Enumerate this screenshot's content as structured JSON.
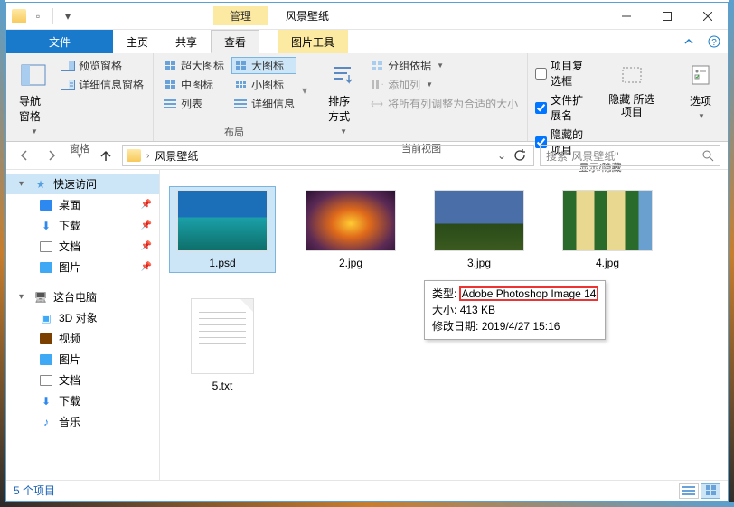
{
  "titlebar": {
    "context_tab": "管理",
    "title": "风景壁纸"
  },
  "menutabs": {
    "file": "文件",
    "home": "主页",
    "share": "共享",
    "view": "查看",
    "picture_tools": "图片工具"
  },
  "ribbon": {
    "panes": {
      "nav_pane": "导航窗格",
      "preview_pane": "预览窗格",
      "details_pane": "详细信息窗格",
      "label": "窗格"
    },
    "layout": {
      "extra_large": "超大图标",
      "large": "大图标",
      "medium": "中图标",
      "small": "小图标",
      "list": "列表",
      "details": "详细信息",
      "label": "布局"
    },
    "current_view": {
      "sort_by": "排序方式",
      "group_by": "分组依据",
      "add_columns": "添加列",
      "fit_columns": "将所有列调整为合适的大小",
      "label": "当前视图"
    },
    "show_hide": {
      "item_checkboxes": "项目复选框",
      "file_ext": "文件扩展名",
      "hidden_items": "隐藏的项目",
      "hide_selected": "隐藏\n所选项目",
      "label": "显示/隐藏"
    },
    "options": {
      "options": "选项",
      "label": ""
    }
  },
  "addressbar": {
    "segment": "风景壁纸",
    "search_placeholder": "搜索\"风景壁纸\""
  },
  "sidebar": {
    "quick_access": "快速访问",
    "desktop": "桌面",
    "downloads": "下载",
    "documents": "文档",
    "pictures": "图片",
    "this_pc": "这台电脑",
    "objects_3d": "3D 对象",
    "videos": "视频",
    "pictures2": "图片",
    "documents2": "文档",
    "downloads2": "下载",
    "music": "音乐"
  },
  "files": [
    {
      "name": "1.psd"
    },
    {
      "name": "2.jpg"
    },
    {
      "name": "3.jpg"
    },
    {
      "name": "4.jpg"
    },
    {
      "name": "5.txt"
    }
  ],
  "tooltip": {
    "type_label": "类型:",
    "type_value": "Adobe Photoshop Image 14",
    "size_label": "大小:",
    "size_value": "413 KB",
    "date_label": "修改日期:",
    "date_value": "2019/4/27 15:16"
  },
  "statusbar": {
    "count": "5 个项目"
  }
}
